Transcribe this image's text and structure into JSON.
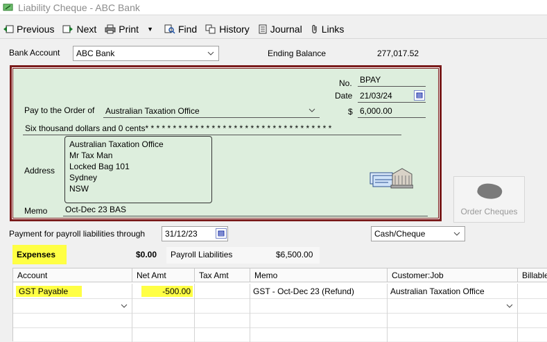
{
  "window": {
    "title": "Liability Cheque - ABC Bank"
  },
  "toolbar": {
    "previous": "Previous",
    "next": "Next",
    "print": "Print",
    "find": "Find",
    "history": "History",
    "journal": "Journal",
    "links": "Links"
  },
  "bank": {
    "label": "Bank Account",
    "value": "ABC Bank",
    "ending_label": "Ending Balance",
    "ending_value": "277,017.52"
  },
  "cheque": {
    "no_label": "No.",
    "no_value": "BPAY",
    "date_label": "Date",
    "date_value": "21/03/24",
    "amount_label": "$",
    "amount_value": "6,000.00",
    "pay_to_label": "Pay to the Order of",
    "pay_to_value": "Australian Taxation Office",
    "amount_words": "Six thousand  dollars and 0 cents* * * * * * * * * * * * * * * * * * * * * * * * * * * * * * * * * *",
    "address_label": "Address",
    "address_lines": [
      "Australian Taxation Office",
      "Mr Tax Man",
      "Locked Bag 101",
      "Sydney",
      "NSW"
    ],
    "memo_label": "Memo",
    "memo_value": "Oct-Dec 23 BAS"
  },
  "order_cheques": "Order Cheques",
  "payroll": {
    "label": "Payment for payroll liabilities through",
    "date": "31/12/23",
    "method": "Cash/Cheque"
  },
  "tabs": {
    "expenses_label": "Expenses",
    "expenses_amount": "$0.00",
    "payroll_label": "Payroll Liabilities",
    "payroll_amount": "$6,500.00"
  },
  "grid": {
    "headers": [
      "Account",
      "Net Amt",
      "Tax Amt",
      "Memo",
      "Customer:Job",
      "Billable"
    ],
    "rows": [
      {
        "account": "GST Payable",
        "net": "-500.00",
        "tax": "",
        "memo": "GST - Oct-Dec 23 (Refund)",
        "customer": "Australian Taxation Office"
      }
    ]
  }
}
